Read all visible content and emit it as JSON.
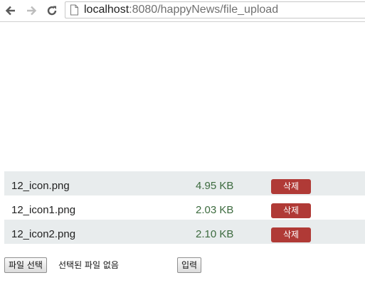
{
  "browser": {
    "url_host": "localhost",
    "url_rest": ":8080/happyNews/file_upload",
    "icons": {
      "back": "arrow-left-icon",
      "forward": "arrow-right-icon",
      "reload": "reload-icon",
      "page": "page-icon"
    }
  },
  "files": [
    {
      "name": "12_icon.png",
      "size": "4.95 KB",
      "delete_label": "삭제"
    },
    {
      "name": "12_icon1.png",
      "size": "2.03 KB",
      "delete_label": "삭제"
    },
    {
      "name": "12_icon2.png",
      "size": "2.10 KB",
      "delete_label": "삭제"
    }
  ],
  "upload": {
    "choose_file_label": "파일 선택",
    "no_file_text": "선택된 파일 없음",
    "submit_label": "입력"
  },
  "colors": {
    "row_shade": "#e8eced",
    "delete_button": "#b03a36",
    "size_text": "#3d6b3f"
  }
}
